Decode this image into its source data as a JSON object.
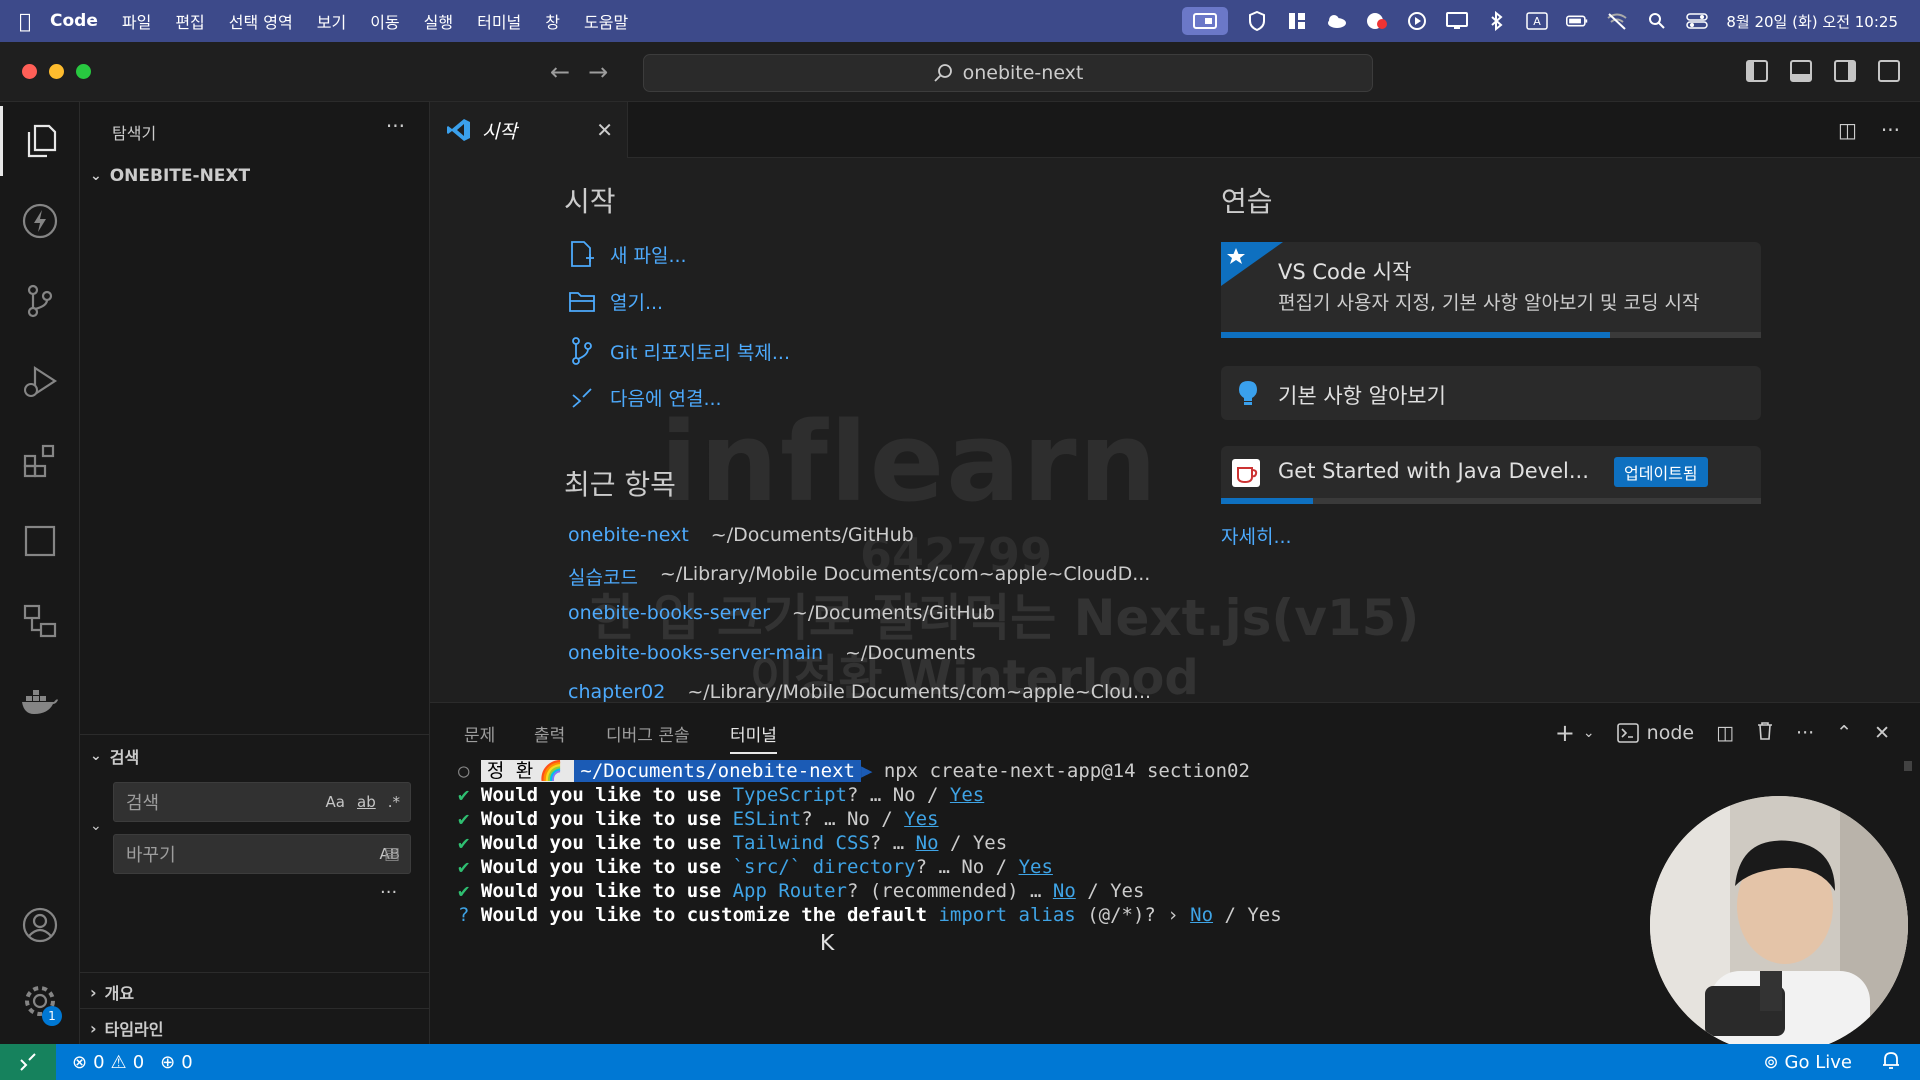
{
  "menubar": {
    "app_name": "Code",
    "items": [
      "파일",
      "편집",
      "선택 영역",
      "보기",
      "이동",
      "실행",
      "터미널",
      "창",
      "도움말"
    ],
    "clock": "8월 20일 (화) 오전 10:25"
  },
  "titlebar": {
    "search_text": "onebite-next"
  },
  "sidebar": {
    "title": "탐색기",
    "folder": "ONEBITE-NEXT",
    "search_section": "검색",
    "search_placeholder": "검색",
    "search_opt_case": "Aa",
    "search_opt_word": "ab",
    "search_opt_regex": ".*",
    "replace_placeholder": "바꾸기",
    "replace_opt": "AB",
    "outline_section": "개요",
    "timeline_section": "타임라인"
  },
  "activity": {
    "settings_badge": "1"
  },
  "tabs": {
    "active_label": "시작"
  },
  "welcome": {
    "start_heading": "시작",
    "start_items": [
      "새 파일...",
      "열기...",
      "Git 리포지토리 복제...",
      "다음에 연결..."
    ],
    "recent_heading": "최근 항목",
    "recent": [
      {
        "name": "onebite-next",
        "path": "~/Documents/GitHub"
      },
      {
        "name": "실습코드",
        "path": "~/Library/Mobile Documents/com~apple~CloudD..."
      },
      {
        "name": "onebite-books-server",
        "path": "~/Documents/GitHub"
      },
      {
        "name": "onebite-books-server-main",
        "path": "~/Documents"
      },
      {
        "name": "chapter02",
        "path": "~/Library/Mobile Documents/com~apple~Clou..."
      }
    ],
    "practice_heading": "연습",
    "cards": [
      {
        "title": "VS Code 시작",
        "desc": "편집기 사용자 지정, 기본 사항 알아보기 및 코딩 시작",
        "progress": 0.72
      },
      {
        "title": "기본 사항 알아보기"
      },
      {
        "title": "Get Started with Java Devel...",
        "badge": "업데이트됨",
        "progress": 0.17
      }
    ],
    "more_link": "자세히...",
    "watermark": {
      "logo": "inflearn",
      "id": "642799",
      "course": "한 입 크기로 잘라먹는 Next.js(v15)",
      "author": "이정환 Winterlood"
    }
  },
  "panel": {
    "tabs": [
      "문제",
      "출력",
      "디버그 콘솔",
      "터미널"
    ],
    "active_tab": "터미널",
    "terminal_name": "node",
    "prompt_user": "정 환",
    "prompt_path": "~/Documents/onebite-next",
    "command": "npx create-next-app@14 section02",
    "lines": [
      {
        "mark": "✔",
        "pre": "Would you like to use ",
        "key": "TypeScript",
        "post": "? … No / ",
        "answer": "Yes"
      },
      {
        "mark": "✔",
        "pre": "Would you like to use ",
        "key": "ESLint",
        "post": "? … No / ",
        "answer": "Yes"
      },
      {
        "mark": "✔",
        "pre": "Would you like to use ",
        "key": "Tailwind CSS",
        "post": "? … ",
        "answer": "No",
        "after": " / Yes"
      },
      {
        "mark": "✔",
        "pre": "Would you like to use ",
        "key": "`src/` directory",
        "post": "? … No / ",
        "answer": "Yes"
      },
      {
        "mark": "✔",
        "pre": "Would you like to use ",
        "key": "App Router",
        "post": "? (recommended) … ",
        "answer": "No",
        "after": " / Yes"
      },
      {
        "mark": "?",
        "pre": "Would you like to customize the default ",
        "key": "import alias",
        "post": " (@/*)? › ",
        "answer": "No",
        "after": " / Yes"
      }
    ]
  },
  "statusbar": {
    "errors": "0",
    "warnings": "0",
    "ports": "0",
    "go_live": "Go Live"
  },
  "colors": {
    "accent": "#0078d4",
    "link": "#4daafc",
    "menubar": "#3d4a8a"
  }
}
